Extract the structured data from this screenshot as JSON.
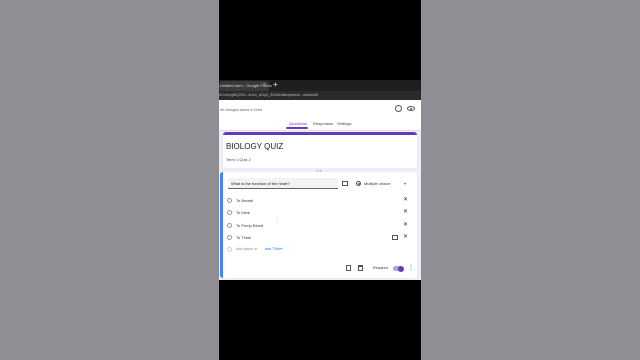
{
  "browser": {
    "tab_title": "Untitled form - Google Forms",
    "tab_close": "×",
    "new_tab": "+",
    "url": "d/1vKmgf8Q2Dh...sHz3_ANyQ_5Xb0edit#question...ckfcs/edit"
  },
  "forms_header": {
    "saved_status": "All changes saved in Drive",
    "tabs": [
      "Questions",
      "Responses",
      "Settings"
    ]
  },
  "form": {
    "title": "BIOLOGY QUIZ",
    "description": "Term 1 Quiz 2",
    "drag_dots": "⠿⠿"
  },
  "question": {
    "text": "What is the function of the heart?",
    "type": "Multiple choice",
    "type_caret": "▾",
    "options": [
      {
        "label": "To Breath"
      },
      {
        "label": "To think"
      },
      {
        "label": "To Pump Blood"
      },
      {
        "label": "To Think"
      }
    ],
    "remove_symbol": "✕",
    "add_option": "Add option  or",
    "add_other": "add \"Other\"",
    "required_label": "Required",
    "more_symbol": "⋮",
    "drag_handle": "⋮"
  }
}
